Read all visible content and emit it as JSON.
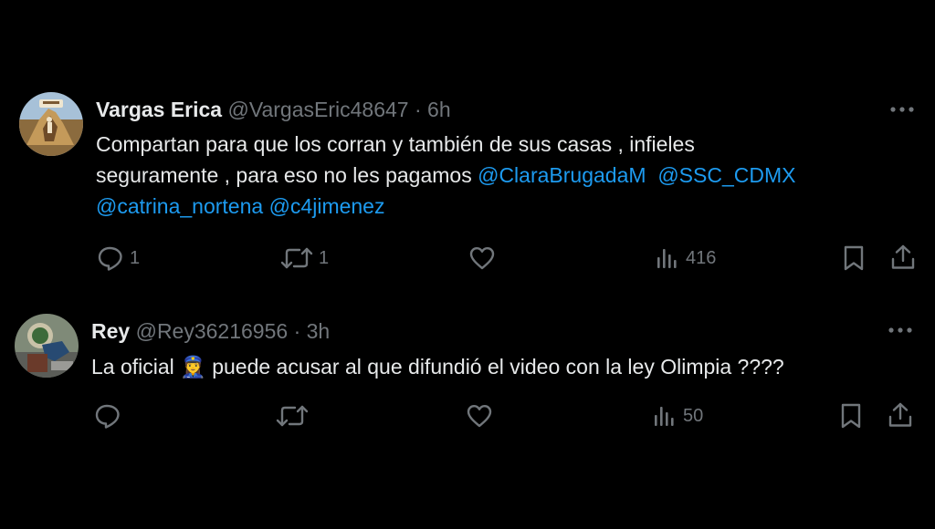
{
  "tweets": [
    {
      "author": {
        "name": "Vargas Erica",
        "handle": "@VargasEric48647",
        "separator": "·",
        "time": "6h"
      },
      "text": {
        "line1": "Compartan para que los corran y también de sus casas , infieles",
        "line2_prefix": "seguramente , para eso no les pagamos ",
        "mention1": "@ClaraBrugadaM",
        "mention2": "@SSC_CDMX",
        "mention3": "@catrina_nortena",
        "mention4": "@c4jimenez"
      },
      "stats": {
        "replies": "1",
        "reposts": "1",
        "likes": "",
        "views": "416"
      }
    },
    {
      "author": {
        "name": "Rey",
        "handle": "@Rey36216956",
        "separator": "·",
        "time": "3h"
      },
      "text": {
        "before_emoji": "La oficial",
        "emoji": "👮‍♀️",
        "after_emoji": " puede acusar al que difundió el video con la ley Olimpia ????"
      },
      "stats": {
        "replies": "",
        "reposts": "",
        "likes": "",
        "views": "50"
      }
    }
  ],
  "colors": {
    "background": "#000000",
    "text": "#e7e9ea",
    "secondary": "#71767b",
    "link": "#1d9bf0"
  },
  "icons": {
    "more": "more-horizontal-icon",
    "reply": "reply-bubble-icon",
    "repost": "repost-arrows-icon",
    "like": "heart-icon",
    "views": "views-bar-chart-icon",
    "bookmark": "bookmark-icon",
    "share": "share-upload-icon"
  }
}
